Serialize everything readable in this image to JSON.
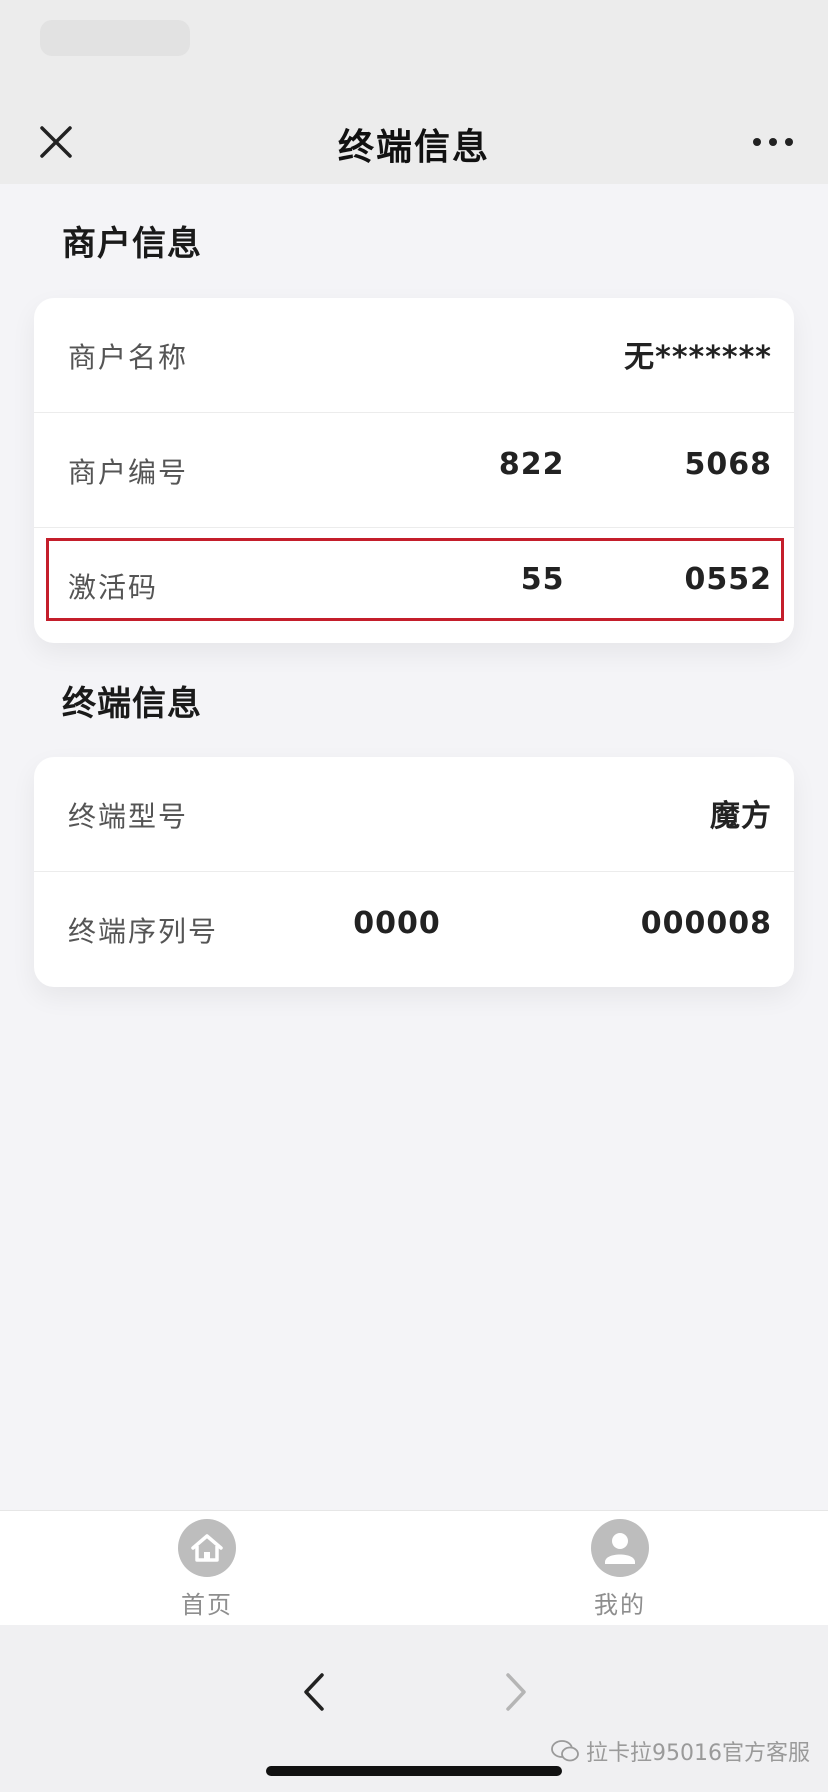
{
  "nav": {
    "title": "终端信息",
    "close_icon": "close-icon",
    "more_icon": "more-icon"
  },
  "merchant_section": {
    "title": "商户信息",
    "rows": [
      {
        "label": "商户名称",
        "value": "无*******"
      },
      {
        "label": "商户编号",
        "value_start": "822",
        "value_end": "5068"
      },
      {
        "label": "激活码",
        "value_start": "55",
        "value_end": "0552"
      }
    ]
  },
  "terminal_section": {
    "title": "终端信息",
    "rows": [
      {
        "label": "终端型号",
        "value": "魔方"
      },
      {
        "label": "终端序列号",
        "value_start": "0000",
        "value_end": "000008"
      }
    ]
  },
  "tabs": [
    {
      "label": "首页",
      "icon": "home-icon"
    },
    {
      "label": "我的",
      "icon": "user-icon"
    }
  ],
  "browser": {
    "back_icon": "chevron-left-icon",
    "forward_icon": "chevron-right-icon"
  },
  "watermark": {
    "text": "拉卡拉95016官方客服"
  },
  "colors": {
    "highlight": "#c41e2b",
    "background": "#f4f4f7",
    "card": "#ffffff"
  }
}
